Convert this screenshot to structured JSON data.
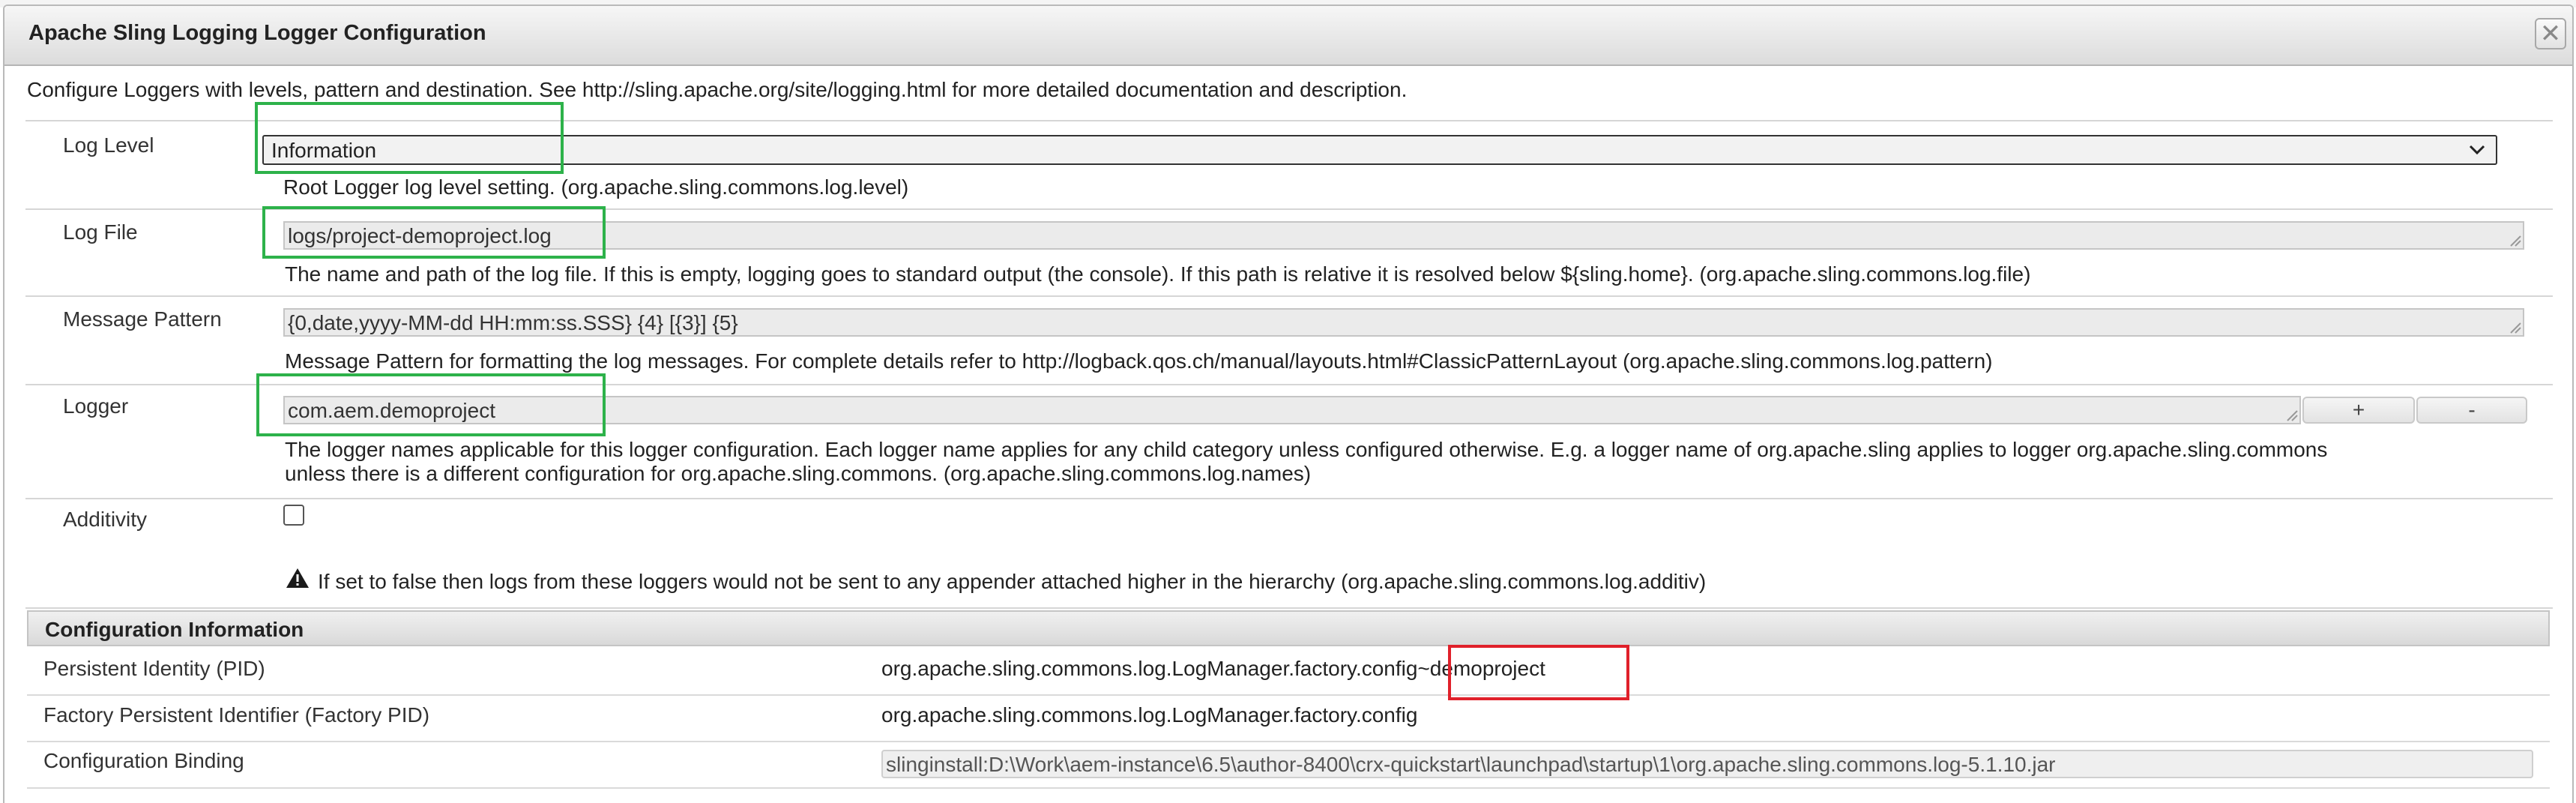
{
  "dialog": {
    "title": "Apache Sling Logging Logger Configuration",
    "close_glyph": "✕",
    "description": "Configure Loggers with levels, pattern and destination. See http://sling.apache.org/site/logging.html for more detailed documentation and description."
  },
  "fields": {
    "log_level": {
      "label": "Log Level",
      "value": "Information",
      "help": "Root Logger log level setting. (org.apache.sling.commons.log.level)"
    },
    "log_file": {
      "label": "Log File",
      "value": "logs/project-demoproject.log",
      "help": "The name and path of the log file. If this is empty, logging goes to standard output (the console). If this path is relative it is resolved below ${sling.home}. (org.apache.sling.commons.log.file)"
    },
    "message_pattern": {
      "label": "Message Pattern",
      "value": "{0,date,yyyy-MM-dd HH:mm:ss.SSS} {4} [{3}] {5}",
      "help": "Message Pattern for formatting the log messages. For complete details refer to http://logback.qos.ch/manual/layouts.html#ClassicPatternLayout (org.apache.sling.commons.log.pattern)"
    },
    "logger": {
      "label": "Logger",
      "value": "com.aem.demoproject",
      "add_label": "+",
      "remove_label": "-",
      "help_line1": "The logger names applicable for this logger configuration. Each logger name applies for any child category unless configured otherwise. E.g. a logger name of org.apache.sling applies to logger org.apache.sling.commons",
      "help_line2": "unless there is a different configuration for org.apache.sling.commons. (org.apache.sling.commons.log.names)"
    },
    "additivity": {
      "label": "Additivity",
      "checked": false,
      "help": "If set to false then logs from these loggers would not be sent to any appender attached higher in the hierarchy (org.apache.sling.commons.log.additiv)"
    }
  },
  "config_info": {
    "header": "Configuration Information",
    "pid_label": "Persistent Identity (PID)",
    "pid_value": "org.apache.sling.commons.log.LogManager.factory.config~demoproject",
    "factory_pid_label": "Factory Persistent Identifier (Factory PID)",
    "factory_pid_value": "org.apache.sling.commons.log.LogManager.factory.config",
    "binding_label": "Configuration Binding",
    "binding_value": "slinginstall:D:\\Work\\aem-instance\\6.5\\author-8400\\crx-quickstart\\launchpad\\startup\\1\\org.apache.sling.commons.log-5.1.10.jar"
  },
  "colors": {
    "highlight_green": "#2db24a",
    "highlight_red": "#e0202a"
  },
  "icons": {
    "close": "close-icon",
    "dropdown": "chevron-down-icon",
    "warning": "warning-icon"
  }
}
